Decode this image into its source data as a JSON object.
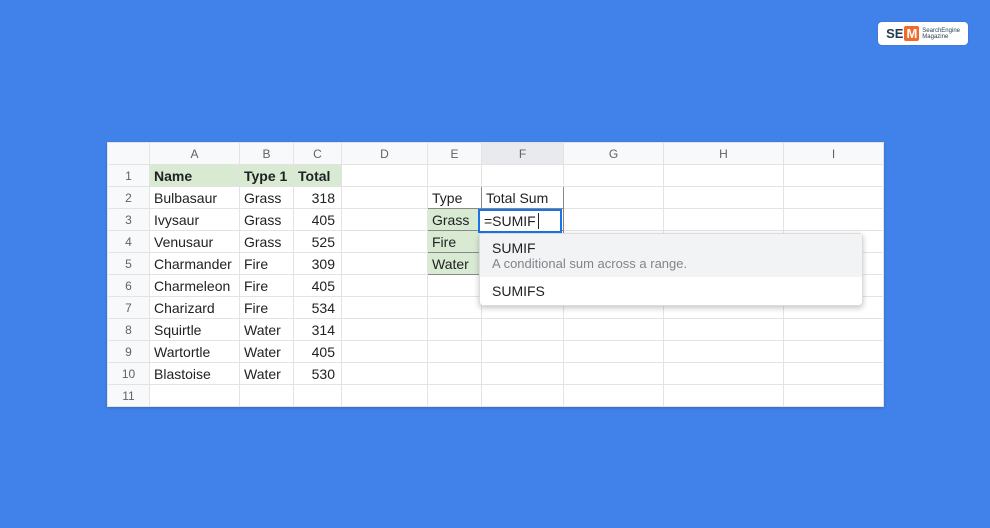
{
  "watermark": {
    "s": "S",
    "e": "E",
    "m": "M",
    "line1": "SearchEngine",
    "line2": "Magazine"
  },
  "columns": [
    "A",
    "B",
    "C",
    "D",
    "E",
    "F",
    "G",
    "H",
    "I"
  ],
  "rows": [
    "1",
    "2",
    "3",
    "4",
    "5",
    "6",
    "7",
    "8",
    "9",
    "10",
    "11"
  ],
  "headers": {
    "A": "Name",
    "B": "Type 1",
    "C": "Total"
  },
  "data": [
    {
      "A": "Bulbasaur",
      "B": "Grass",
      "C": "318"
    },
    {
      "A": "Ivysaur",
      "B": "Grass",
      "C": "405"
    },
    {
      "A": "Venusaur",
      "B": "Grass",
      "C": "525"
    },
    {
      "A": "Charmander",
      "B": "Fire",
      "C": "309"
    },
    {
      "A": "Charmeleon",
      "B": "Fire",
      "C": "405"
    },
    {
      "A": "Charizard",
      "B": "Fire",
      "C": "534"
    },
    {
      "A": "Squirtle",
      "B": "Water",
      "C": "314"
    },
    {
      "A": "Wartortle",
      "B": "Water",
      "C": "405"
    },
    {
      "A": "Blastoise",
      "B": "Water",
      "C": "530"
    }
  ],
  "side": {
    "E2": "Type",
    "F2": "Total Sum",
    "E3": "Grass",
    "E4": "Fire",
    "E5": "Water"
  },
  "activeCell": {
    "value": "=SUMIF"
  },
  "suggest": {
    "items": [
      {
        "name": "SUMIF",
        "desc": "A conditional sum across a range."
      },
      {
        "name": "SUMIFS",
        "desc": ""
      }
    ]
  }
}
